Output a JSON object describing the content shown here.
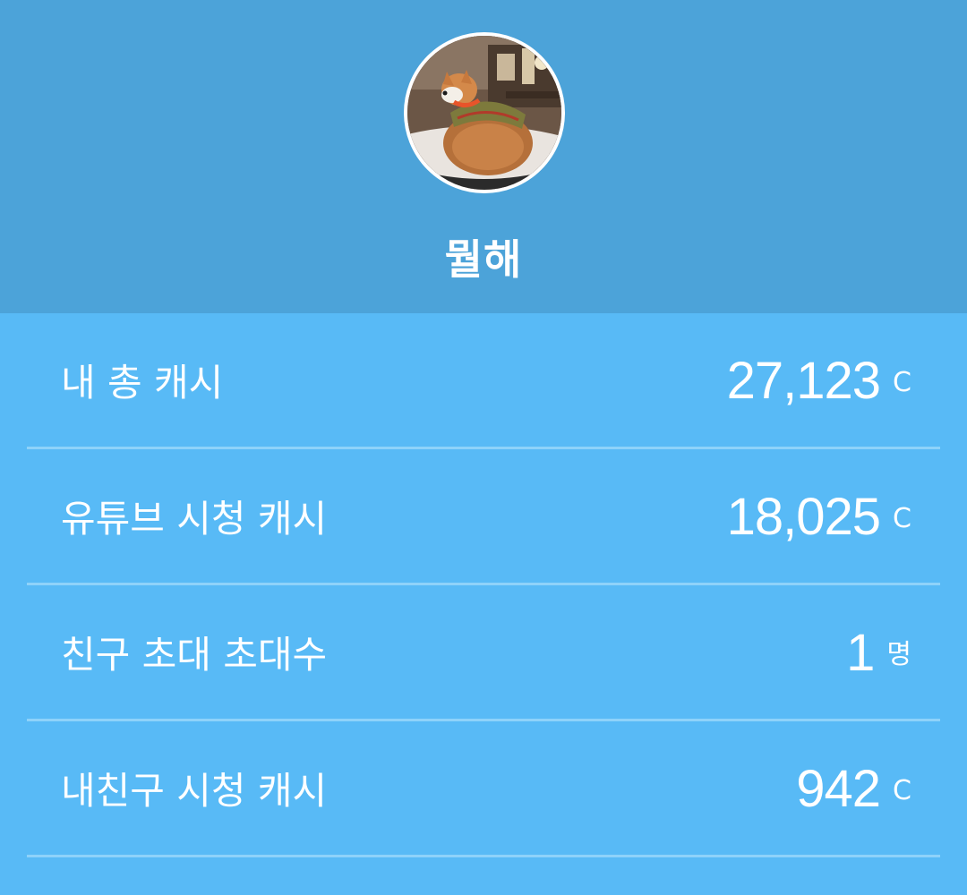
{
  "profile": {
    "avatar_icon": "corgi-dog-photo",
    "username": "뭘해"
  },
  "stats": [
    {
      "label": "내 총 캐시",
      "value": "27,123",
      "unit": "C"
    },
    {
      "label": "유튜브 시청 캐시",
      "value": "18,025",
      "unit": "C"
    },
    {
      "label": "친구 초대 초대수",
      "value": "1",
      "unit": "명"
    },
    {
      "label": "내친구 시청 캐시",
      "value": "942",
      "unit": "C"
    }
  ],
  "colors": {
    "header_bg": "#4CA3D9",
    "body_bg": "#58BAF6",
    "divider": "#8ED2FA",
    "text": "#FFFFFF"
  }
}
